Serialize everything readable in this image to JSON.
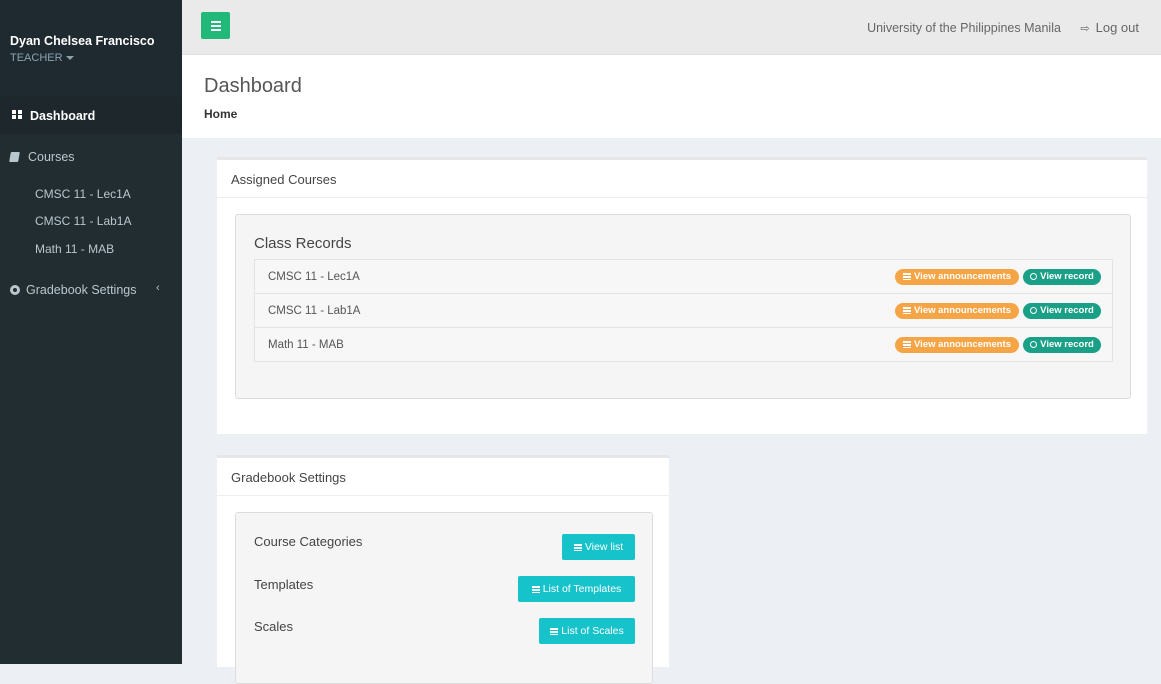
{
  "user": {
    "name": "Dyan Chelsea Francisco",
    "role": "TEACHER"
  },
  "sidebar": {
    "dashboard": "Dashboard",
    "courses": "Courses",
    "course_items": [
      "CMSC 11 - Lec1A",
      "CMSC 11 - Lab1A",
      "Math 11 - MAB"
    ],
    "gradebook_settings": "Gradebook Settings"
  },
  "header": {
    "institution": "University of the Philippines Manila",
    "logout": "Log out"
  },
  "page": {
    "title": "Dashboard",
    "breadcrumb": "Home"
  },
  "assigned_courses": {
    "title": "Assigned Courses",
    "panel_title": "Class Records",
    "announcements_label": "View announcements",
    "record_label": "View record",
    "records": [
      "CMSC 11 - Lec1A",
      "CMSC 11 - Lab1A",
      "Math 11 - MAB"
    ]
  },
  "gradebook": {
    "title": "Gradebook Settings",
    "course_categories": "Course Categories",
    "view_list": "View list",
    "templates": "Templates",
    "list_of_templates": "List of Templates",
    "scales": "Scales",
    "list_of_scales": "List of Scales"
  },
  "colors": {
    "sidebar_bg": "#222d32",
    "toggle_green": "#22b87a",
    "announcement_orange": "#f5a545",
    "record_green": "#1aa086",
    "teal_button": "#17c3cb"
  },
  "icons": {
    "dashboard": "th-large-icon",
    "courses": "book-icon",
    "gradebook": "cog-icon",
    "logout": "sign-out-icon",
    "toggle": "hamburger-icon"
  }
}
